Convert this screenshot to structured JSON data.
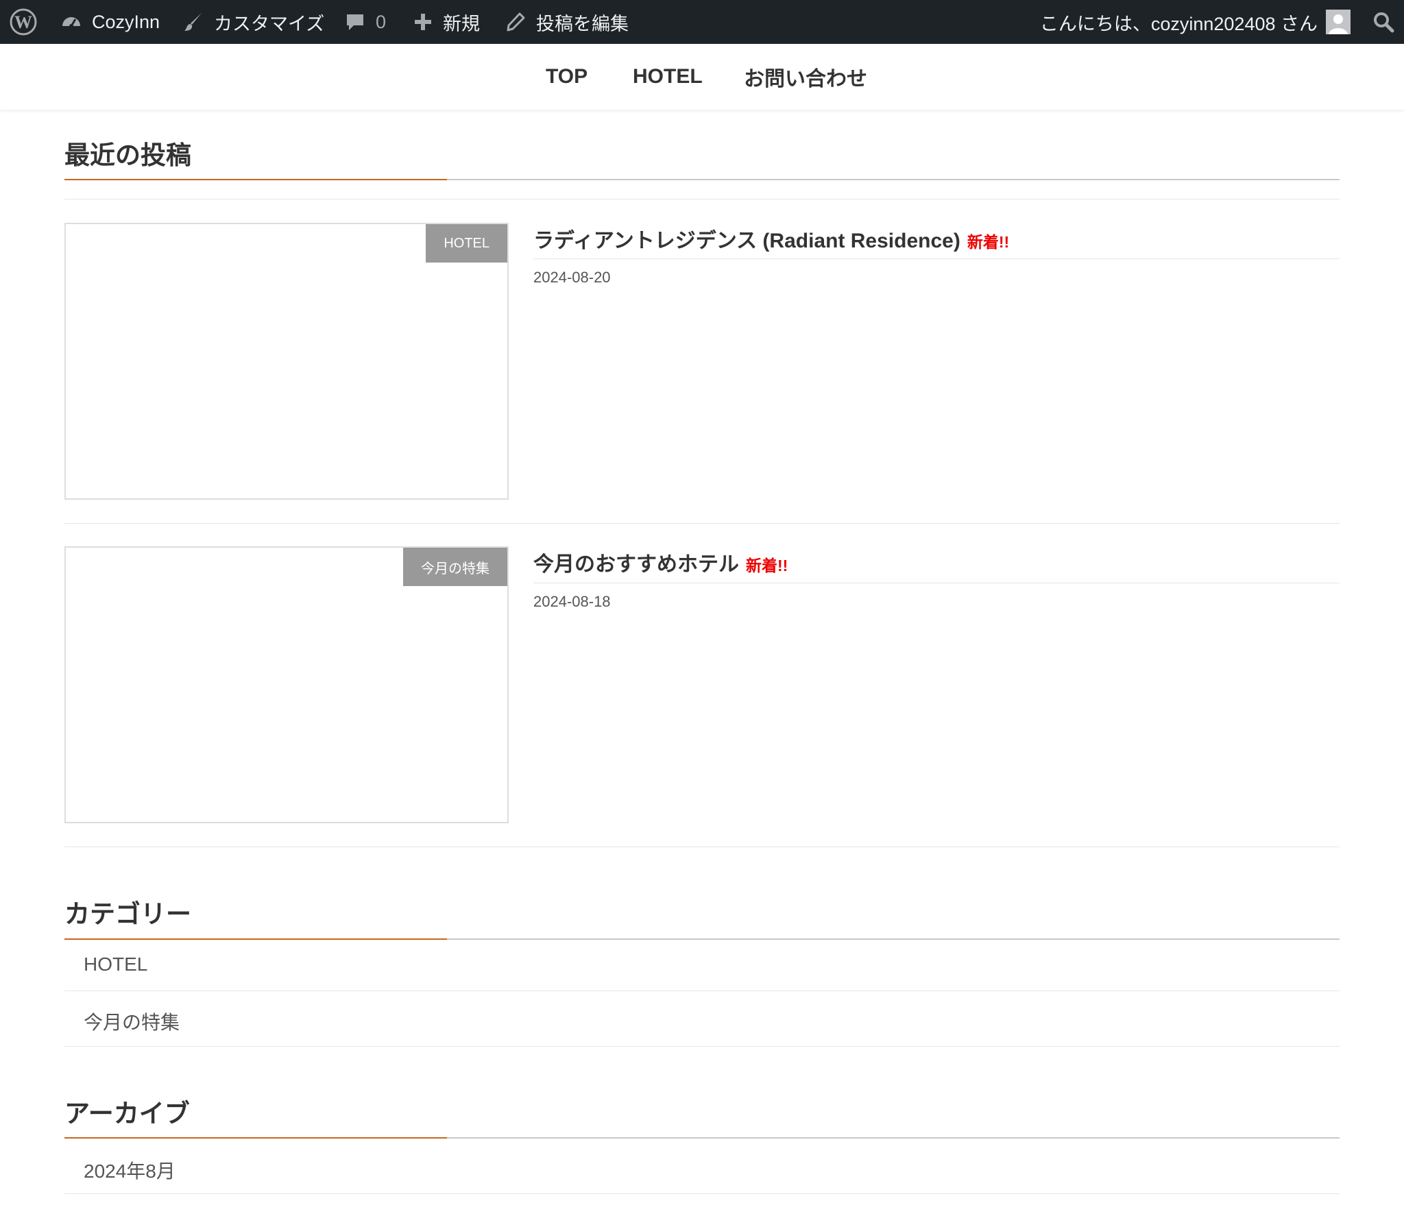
{
  "adminbar": {
    "site_name": "CozyInn",
    "customize": "カスタマイズ",
    "comments_count": "0",
    "new_label": "新規",
    "edit_post": "投稿を編集",
    "greeting": "こんにちは、cozyinn202408 さん",
    "icons": [
      "wordpress-logo-icon",
      "dashboard-icon",
      "brush-icon",
      "comment-icon",
      "plus-icon",
      "pencil-icon",
      "avatar-icon",
      "search-icon"
    ]
  },
  "nav": {
    "items": [
      {
        "label": "TOP"
      },
      {
        "label": "HOTEL"
      },
      {
        "label": "お問い合わせ"
      }
    ]
  },
  "recent": {
    "heading": "最近の投稿",
    "posts": [
      {
        "category": "HOTEL",
        "title": "ラディアントレジデンス (Radiant Residence)",
        "new_label": "新着!!",
        "date": "2024-08-20"
      },
      {
        "category": "今月の特集",
        "title": "今月のおすすめホテル",
        "new_label": "新着!!",
        "date": "2024-08-18"
      }
    ]
  },
  "categories": {
    "heading": "カテゴリー",
    "items": [
      {
        "label": "HOTEL"
      },
      {
        "label": "今月の特集"
      }
    ]
  },
  "archives": {
    "heading": "アーカイブ",
    "items": [
      {
        "label": "2024年8月"
      }
    ]
  },
  "colors": {
    "adminbar_bg": "#1d2327",
    "accent": "#c8661e",
    "badge_bg": "#999999",
    "new_red": "#ee0000"
  }
}
